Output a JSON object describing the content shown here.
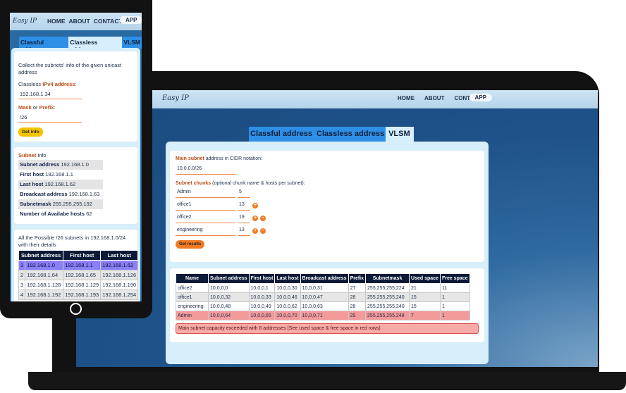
{
  "brand": "Easy IP",
  "nav": {
    "home": "HOME",
    "about": "ABOUT",
    "contact": "CONTACT",
    "app": "APP"
  },
  "tabs": {
    "classful": "Classful address",
    "classless": "Classless address",
    "vlsm": "VLSM"
  },
  "laptop": {
    "main_subnet_label": "Main subnet",
    "main_subnet_suffix": " address in CIDR notation:",
    "main_subnet_value": "10.0.0.0/26",
    "chunks_label": "Subnet chunks",
    "chunks_suffix": " (optional chunk name & hosts per subnet):",
    "chunks": [
      {
        "name": "Admin",
        "hosts": "5"
      },
      {
        "name": "office1",
        "hosts": "13"
      },
      {
        "name": "office2",
        "hosts": "19"
      },
      {
        "name": "engineering",
        "hosts": "13"
      }
    ],
    "get_results": "Get results",
    "table": {
      "headers": [
        "Name",
        "Subnet address",
        "First host",
        "Last host",
        "Broadcast address",
        "Prefix",
        "Subnetmask",
        "Used space",
        "Free space"
      ],
      "rows": [
        [
          "office2",
          "10,0,0,0",
          "10,0,0,1",
          "10,0,0,30",
          "10,0,0,31",
          "27",
          "255,255,255,224",
          "21",
          "11"
        ],
        [
          "office1",
          "10,0,0,32",
          "10,0,0,33",
          "10,0,0,46",
          "10,0,0,47",
          "28",
          "255,255,255,240",
          "15",
          "1"
        ],
        [
          "engineering",
          "10,0,0,48",
          "10,0,0,49",
          "10,0,0,62",
          "10,0,0,63",
          "28",
          "255,255,255,240",
          "15",
          "1"
        ],
        [
          "Admin",
          "10,0,0,64",
          "10,0,0,65",
          "10,0,0,70",
          "10,0,0,71",
          "29",
          "255,255,255,248",
          "7",
          "1"
        ]
      ]
    },
    "message": "Main subnet capacity exceeded with 8 addresses (See used space & free space in red rows)"
  },
  "phone": {
    "intro": "Collect the subnets' info of the given unicast address",
    "ipv4_prefix": "Classless ",
    "ipv4_label": "IPv4 address",
    "ipv4_value": "192.168.1.34",
    "mask_label": "Mask",
    "mask_or": " or ",
    "prefix_label": "Prefix",
    "mask_value": "/26",
    "get_info": "Get info",
    "subnet_label": "Subnet",
    "subnet_info": " info",
    "info": {
      "subnet_address_k": "Subnet address",
      "subnet_address_v": "192.168.1.0",
      "first_host_k": "First host",
      "first_host_v": "192.168.1.1",
      "last_host_k": "Last host",
      "last_host_v": "192.168.1.62",
      "broadcast_k": "Broadcast address",
      "broadcast_v": "192.168.1.63",
      "subnetmask_k": "Subnetmask",
      "subnetmask_v": "255.255.255.192",
      "avail_k": "Number of Availabe hosts",
      "avail_v": "62"
    },
    "possible_text": "All the Possible /26 subnets in 192.168.1.0/24 with their details",
    "table": {
      "headers": [
        "Subnet address",
        "First host",
        "Last host"
      ],
      "rows": [
        [
          "1",
          "192.168.1.0",
          "192.168.1.1",
          "192.168.1.62"
        ],
        [
          "2",
          "192.168.1.64",
          "192.168.1.65",
          "192.168.1.126"
        ],
        [
          "3",
          "192.168.1.128",
          "192.168.1.129",
          "192.168.1.190"
        ],
        [
          "4",
          "192.168.1.192",
          "192.168.1.193",
          "192.168.1.254"
        ]
      ]
    }
  }
}
